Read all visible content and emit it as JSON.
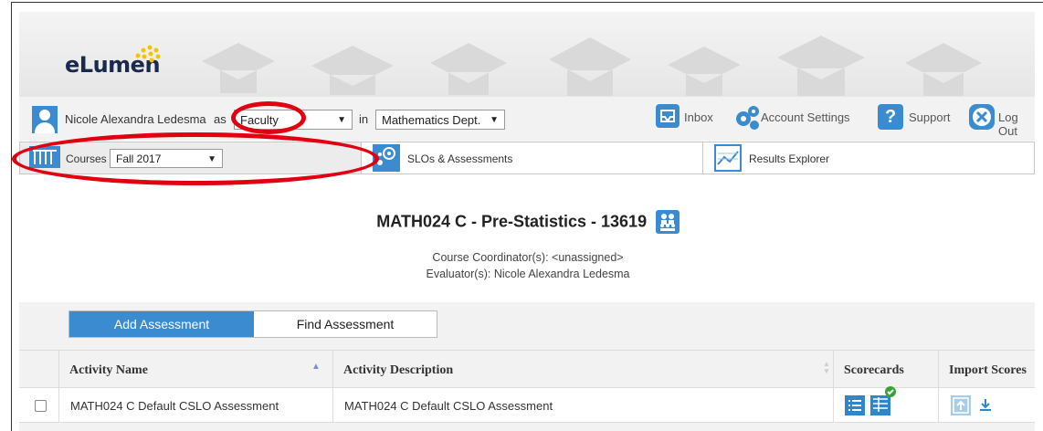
{
  "header": {
    "logo_text": "eLumen"
  },
  "user_bar": {
    "user_name": "Nicole Alexandra Ledesma",
    "as_label": "as",
    "role_value": "Faculty",
    "in_label": "in",
    "dept_value": "Mathematics Dept.",
    "inbox_label": "Inbox",
    "account_settings_label": "Account Settings",
    "support_label": "Support",
    "logout_label": "Log Out"
  },
  "tabs": {
    "courses_label": "Courses",
    "term_value": "Fall 2017",
    "slos_label": "SLOs & Assessments",
    "results_label": "Results Explorer"
  },
  "course": {
    "title": "MATH024 C - Pre-Statistics - 13619",
    "coordinator": "Course Coordinator(s): <unassigned>",
    "evaluator": "Evaluator(s): Nicole Alexandra Ledesma"
  },
  "assessment_actions": {
    "add_label": "Add Assessment",
    "find_label": "Find Assessment"
  },
  "table": {
    "columns": [
      "Activity Name",
      "Activity Description",
      "Scorecards",
      "Import Scores"
    ],
    "rows": [
      {
        "name": "MATH024 C Default CSLO Assessment",
        "description": "MATH024 C Default CSLO Assessment"
      }
    ]
  },
  "colors": {
    "accent": "#3a8bd0",
    "highlight_ring": "#e0000f",
    "check_badge": "#3aa23a"
  },
  "icons": [
    "user-avatar-icon",
    "inbox-icon",
    "gears-icon",
    "question-icon",
    "close-icon",
    "columns-icon",
    "target-icon",
    "chart-icon",
    "people-icon",
    "list-icon",
    "table-check-icon",
    "upload-icon",
    "download-icon",
    "chevron-down-icon",
    "sort-asc-icon",
    "sort-both-icon"
  ]
}
